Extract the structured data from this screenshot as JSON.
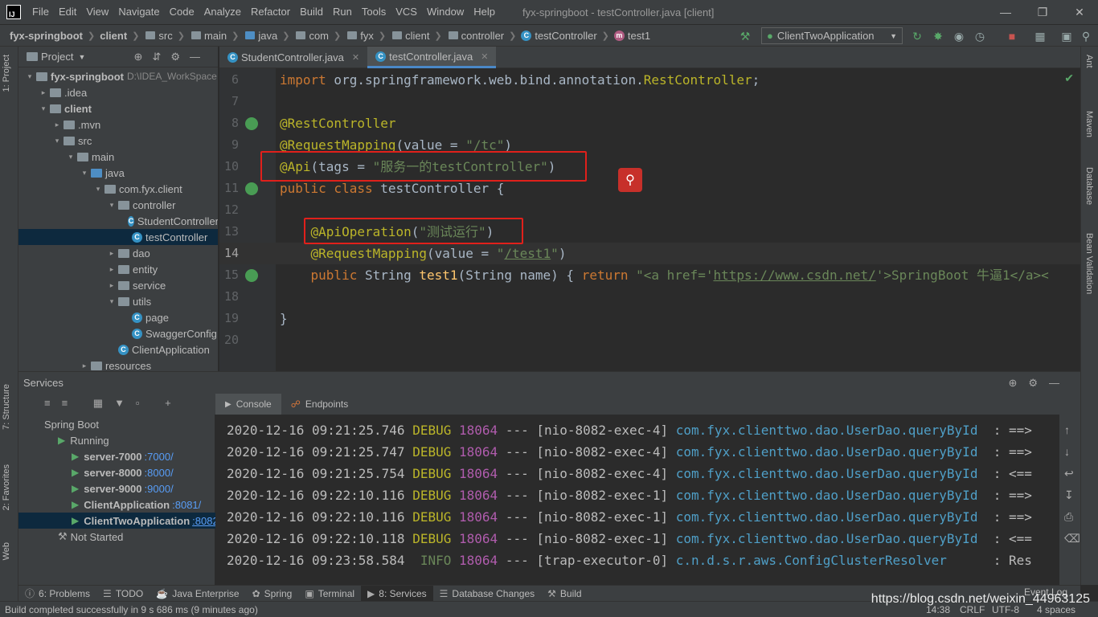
{
  "menubar": {
    "items": [
      "File",
      "Edit",
      "View",
      "Navigate",
      "Code",
      "Analyze",
      "Refactor",
      "Build",
      "Run",
      "Tools",
      "VCS",
      "Window",
      "Help"
    ],
    "window_title": "fyx-springboot - testController.java [client]"
  },
  "navbar": {
    "crumbs": [
      "fyx-springboot",
      "client",
      "src",
      "main",
      "java",
      "com",
      "fyx",
      "client",
      "controller",
      "testController",
      "test1"
    ],
    "run_config": "ClientTwoApplication"
  },
  "project": {
    "header": "Project",
    "tree": [
      {
        "label": "fyx-springboot",
        "extra": "D:\\IDEA_WorkSpace",
        "indent": 0,
        "type": "module",
        "expanded": true
      },
      {
        "label": ".idea",
        "indent": 1,
        "type": "folder",
        "expanded": false
      },
      {
        "label": "client",
        "indent": 1,
        "type": "module",
        "expanded": true
      },
      {
        "label": ".mvn",
        "indent": 2,
        "type": "folder",
        "expanded": false
      },
      {
        "label": "src",
        "indent": 2,
        "type": "folder",
        "expanded": true
      },
      {
        "label": "main",
        "indent": 3,
        "type": "folder",
        "expanded": true
      },
      {
        "label": "java",
        "indent": 4,
        "type": "folder-blue",
        "expanded": true
      },
      {
        "label": "com.fyx.client",
        "indent": 5,
        "type": "folder",
        "expanded": true
      },
      {
        "label": "controller",
        "indent": 6,
        "type": "folder",
        "expanded": true
      },
      {
        "label": "StudentController",
        "indent": 7,
        "type": "class"
      },
      {
        "label": "testController",
        "indent": 7,
        "type": "class",
        "selected": true
      },
      {
        "label": "dao",
        "indent": 6,
        "type": "folder",
        "expanded": false
      },
      {
        "label": "entity",
        "indent": 6,
        "type": "folder",
        "expanded": false
      },
      {
        "label": "service",
        "indent": 6,
        "type": "folder",
        "expanded": false
      },
      {
        "label": "utils",
        "indent": 6,
        "type": "folder",
        "expanded": true
      },
      {
        "label": "page",
        "indent": 7,
        "type": "class"
      },
      {
        "label": "SwaggerConfig",
        "indent": 7,
        "type": "class"
      },
      {
        "label": "ClientApplication",
        "indent": 6,
        "type": "class"
      },
      {
        "label": "resources",
        "indent": 4,
        "type": "folder",
        "expanded": false
      }
    ]
  },
  "editor": {
    "tabs": [
      {
        "label": "StudentController.java",
        "active": false
      },
      {
        "label": "testController.java",
        "active": true
      }
    ],
    "lines": [
      {
        "num": "6",
        "html": "<span class='kw'>import</span> org.springframework.web.bind.annotation.<span class='an'>RestController</span>;"
      },
      {
        "num": "7",
        "html": ""
      },
      {
        "num": "8",
        "html": "<span class='an'>@RestController</span>",
        "gutter": true
      },
      {
        "num": "9",
        "html": "<span class='an'>@RequestMapping</span>(value = <span class='st'>\"/tc\"</span>)"
      },
      {
        "num": "10",
        "html": "<span class='an'>@Api</span>(tags = <span class='st'>\"服务一的testController\"</span>)"
      },
      {
        "num": "11",
        "html": "<span class='kw'>public class</span> testController {",
        "gutter": true
      },
      {
        "num": "12",
        "html": ""
      },
      {
        "num": "13",
        "html": "    <span class='an'>@ApiOperation</span>(<span class='st'>\"测试运行\"</span>)"
      },
      {
        "num": "14",
        "html": "    <span class='an'>@RequestMapping</span>(value = <span class='st'>\"<span class='url'>/test1</span>\"</span>)",
        "current": true
      },
      {
        "num": "15",
        "html": "    <span class='kw'>public</span> String <span class='fn'>test1</span>(String name) { <span class='kw'>return</span> <span class='st'>\"&lt;a href='<span class='url'>https://www.csdn.net/</span>'&gt;SpringBoot 牛逼1&lt;/a&gt;&lt;</span>",
        "gutter": true
      },
      {
        "num": "18",
        "html": ""
      },
      {
        "num": "19",
        "html": "}"
      },
      {
        "num": "20",
        "html": ""
      }
    ]
  },
  "services": {
    "header": "Services",
    "console_tabs": [
      "Console",
      "Endpoints"
    ],
    "tree": [
      {
        "label": "Spring Boot",
        "indent": 0
      },
      {
        "label": "Running",
        "indent": 1,
        "play": true
      },
      {
        "label": "server-7000",
        "port": ":7000/",
        "indent": 2,
        "play": true,
        "bold": true
      },
      {
        "label": "server-8000",
        "port": ":8000/",
        "indent": 2,
        "play": true,
        "bold": true
      },
      {
        "label": "server-9000",
        "port": ":9000/",
        "indent": 2,
        "play": true,
        "bold": true
      },
      {
        "label": "ClientApplication",
        "port": ":8081/",
        "indent": 2,
        "play": true,
        "bold": true
      },
      {
        "label": "ClientTwoApplication",
        "port": ":8082/",
        "indent": 2,
        "play": true,
        "bold": true,
        "selected": true
      },
      {
        "label": "Not Started",
        "indent": 1
      }
    ],
    "log": [
      {
        "ts": "2020-12-16 09:21:25.746",
        "level": "DEBUG",
        "pid": "18064",
        "thread": "[nio-8082-exec-4]",
        "logger": "com.fyx.clienttwo.dao.UserDao.queryById",
        "msg": " : ==>"
      },
      {
        "ts": "2020-12-16 09:21:25.747",
        "level": "DEBUG",
        "pid": "18064",
        "thread": "[nio-8082-exec-4]",
        "logger": "com.fyx.clienttwo.dao.UserDao.queryById",
        "msg": " : ==>"
      },
      {
        "ts": "2020-12-16 09:21:25.754",
        "level": "DEBUG",
        "pid": "18064",
        "thread": "[nio-8082-exec-4]",
        "logger": "com.fyx.clienttwo.dao.UserDao.queryById",
        "msg": " : <=="
      },
      {
        "ts": "2020-12-16 09:22:10.116",
        "level": "DEBUG",
        "pid": "18064",
        "thread": "[nio-8082-exec-1]",
        "logger": "com.fyx.clienttwo.dao.UserDao.queryById",
        "msg": " : ==>"
      },
      {
        "ts": "2020-12-16 09:22:10.116",
        "level": "DEBUG",
        "pid": "18064",
        "thread": "[nio-8082-exec-1]",
        "logger": "com.fyx.clienttwo.dao.UserDao.queryById",
        "msg": " : ==>"
      },
      {
        "ts": "2020-12-16 09:22:10.118",
        "level": "DEBUG",
        "pid": "18064",
        "thread": "[nio-8082-exec-1]",
        "logger": "com.fyx.clienttwo.dao.UserDao.queryById",
        "msg": " : <=="
      },
      {
        "ts": "2020-12-16 09:23:58.584",
        "level": " INFO",
        "pid": "18064",
        "thread": "[trap-executor-0]",
        "logger": "c.n.d.s.r.aws.ConfigClusterResolver    ",
        "msg": " : Res"
      }
    ]
  },
  "bottom_tabs": [
    "6: Problems",
    "TODO",
    "Java Enterprise",
    "Spring",
    "Terminal",
    "8: Services",
    "Database Changes",
    "Build"
  ],
  "event_log": "Event Log",
  "status": {
    "message": "Build completed successfully in 9 s 686 ms (9 minutes ago)",
    "position": "14:38",
    "line_sep": "CRLF",
    "encoding": "UTF-8",
    "indent": "4 spaces"
  },
  "watermark": "https://blog.csdn.net/weixin_44963125",
  "side_tabs": {
    "left": [
      "1: Project",
      "7: Structure",
      "2: Favorites",
      "Web"
    ],
    "right": [
      "Ant",
      "Maven",
      "Database",
      "Bean Validation"
    ]
  },
  "colors": {
    "accent": "#4a88c7",
    "highlight_box": "#e0201b",
    "run_green": "#59a869"
  }
}
